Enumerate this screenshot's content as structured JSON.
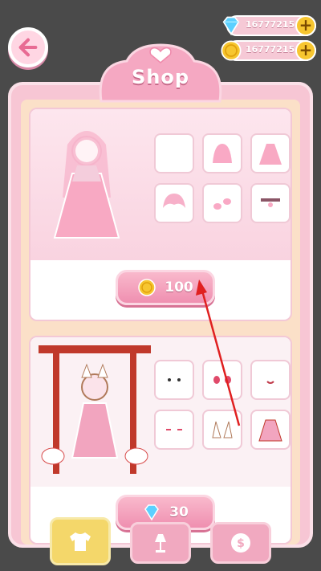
{
  "header": {
    "title": "Shop",
    "diamonds": "16777215",
    "coins": "16777215"
  },
  "items": [
    {
      "price": "100",
      "currency": "coin"
    },
    {
      "price": "30",
      "currency": "diamond"
    }
  ],
  "nav": {
    "tabs": [
      "shirt-icon",
      "lamp-icon",
      "dollar-icon"
    ]
  },
  "colors": {
    "pink": "#f7c6d4",
    "accent": "#ef8fb0",
    "gold": "#f7c630",
    "arrow": "#e02020"
  }
}
